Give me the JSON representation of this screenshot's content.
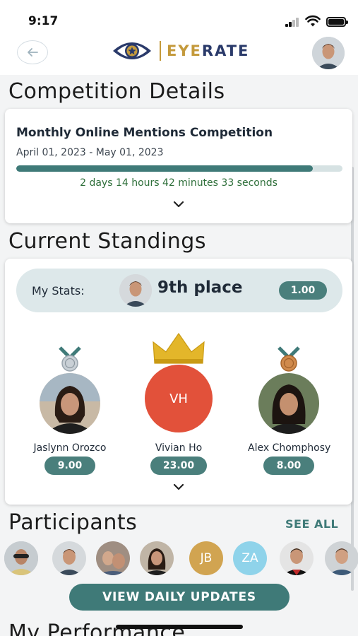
{
  "status_bar": {
    "time": "9:17"
  },
  "header": {
    "logo": {
      "eye_text": "EYE",
      "rate_text": "RATE"
    }
  },
  "competition_details": {
    "title": "Competition Details",
    "name": "Monthly Online Mentions Competition",
    "dates": "April 01, 2023 - May 01, 2023",
    "progress_fraction": 0.91,
    "countdown": "2 days 14 hours 42 minutes 33 seconds"
  },
  "current_standings": {
    "title": "Current Standings",
    "my_stats": {
      "label": "My Stats:",
      "place": "9th place",
      "score": "1.00"
    },
    "podium": [
      {
        "rank": 2,
        "name": "Jaslynn Orozco",
        "score": "9.00",
        "medal": "silver-medal-icon"
      },
      {
        "rank": 1,
        "name": "Vivian Ho",
        "initials": "VH",
        "score": "23.00",
        "medal": "crown-icon"
      },
      {
        "rank": 3,
        "name": "Alex Chomphosy",
        "score": "8.00",
        "medal": "bronze-medal-icon"
      }
    ]
  },
  "participants": {
    "title": "Participants",
    "see_all_label": "SEE ALL",
    "list": [
      {
        "type": "photo"
      },
      {
        "type": "photo"
      },
      {
        "type": "photo"
      },
      {
        "type": "photo"
      },
      {
        "type": "initials",
        "initials": "JB",
        "color": "#d1a451"
      },
      {
        "type": "initials",
        "initials": "ZA",
        "color": "#8fd3ea"
      },
      {
        "type": "photo"
      },
      {
        "type": "photo"
      }
    ]
  },
  "daily_updates_label": "VIEW DAILY UPDATES",
  "my_performance": {
    "title": "My Performance"
  },
  "colors": {
    "accent": "#3f7a78",
    "logo_gold": "#c49a3c",
    "logo_navy": "#2a3a6a",
    "first_place_avatar": "#e2513a",
    "countdown_green": "#2e6f3a"
  }
}
